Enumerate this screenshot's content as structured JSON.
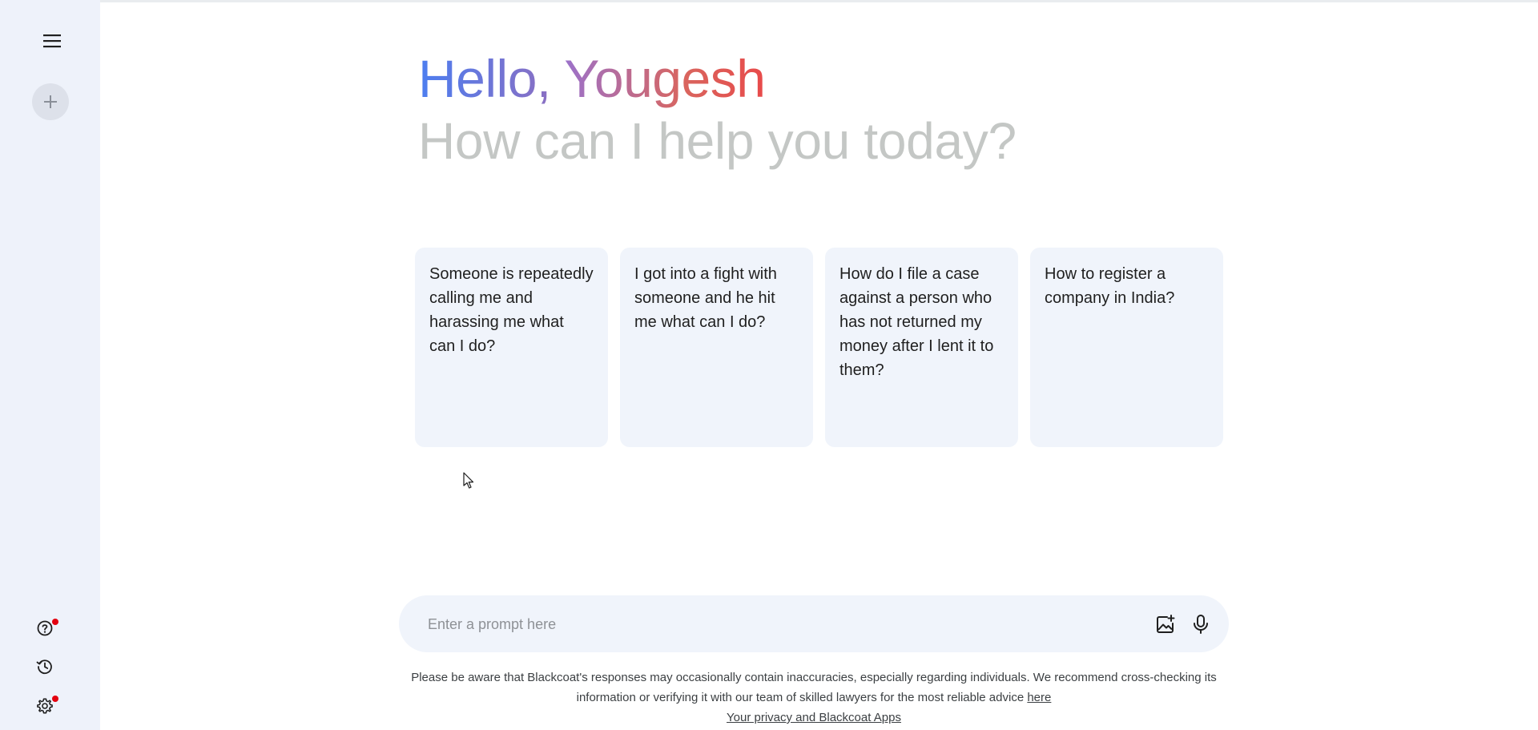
{
  "sidebar": {
    "menu_icon": "hamburger-menu-icon",
    "new_chat_icon": "plus-icon",
    "help_icon": "help-circle-icon",
    "history_icon": "history-clock-icon",
    "settings_icon": "gear-icon",
    "notification_color": "#e3000f"
  },
  "greeting": {
    "hello": "Hello,",
    "name": "Yougesh",
    "subtitle": "How can I help you today?"
  },
  "suggestions": [
    {
      "text": "Someone is repeatedly calling me and harassing me what can I do?"
    },
    {
      "text": "I got into a fight with someone and he hit me what can I do?"
    },
    {
      "text": "How do I file a case against a person who has not returned my money after I lent it to them?"
    },
    {
      "text": "How to register a company in India?"
    }
  ],
  "prompt": {
    "placeholder": "Enter a prompt here",
    "value": "",
    "image_icon": "add-image-icon",
    "mic_icon": "microphone-icon"
  },
  "disclaimer": {
    "text": "Please be aware that Blackcoat's responses may occasionally contain inaccuracies, especially regarding individuals. We recommend cross-checking its information or verifying it with our team of skilled lawyers for the most reliable advice ",
    "link_label": "here",
    "privacy_label": "Your privacy and Blackcoat Apps"
  },
  "colors": {
    "sidebar_bg": "#eef2fa",
    "card_bg": "#f0f4fb",
    "greeting_blue": "#4c7ef0",
    "greeting_red": "#e84a4a",
    "subtitle_gray": "#c4c7c5"
  }
}
